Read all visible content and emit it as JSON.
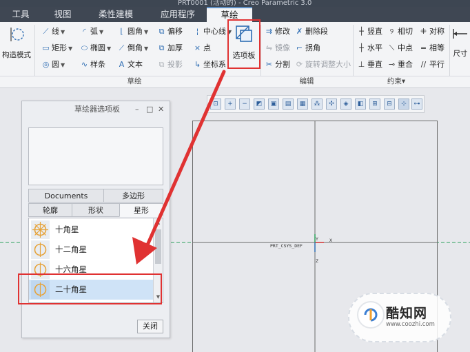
{
  "window": {
    "title": "PRT0001 (活动的) - Creo Parametric 3.0"
  },
  "tabs": [
    {
      "label": "工具",
      "active": false
    },
    {
      "label": "视图",
      "active": false
    },
    {
      "label": "柔性建模",
      "active": false
    },
    {
      "label": "应用程序",
      "active": false
    },
    {
      "label": "草绘",
      "active": true
    }
  ],
  "ribbon": {
    "construction_mode": "构造模式",
    "sketch_col1": [
      "线",
      "矩形",
      "圆"
    ],
    "sketch_col2": [
      "弧",
      "椭圆",
      "样条"
    ],
    "sketch_col3": [
      "圆角",
      "倒角",
      "文本"
    ],
    "sketch_col4": [
      "偏移",
      "加厚",
      "投影"
    ],
    "sketch_col5": [
      "中心线",
      "点",
      "坐标系"
    ],
    "palette_button": "选项板",
    "edit_col1": [
      "修改",
      "镜像",
      "分割"
    ],
    "edit_col2": [
      "删除段",
      "拐角",
      "旋转调整大小"
    ],
    "constraint_col1": [
      "竖直",
      "水平",
      "垂直"
    ],
    "constraint_col2": [
      "相切",
      "中点",
      "重合"
    ],
    "constraint_col3": [
      "对称",
      "相等",
      "平行"
    ],
    "dimension": "尺寸",
    "groups": {
      "sketch": "草绘",
      "edit": "编辑",
      "constraint": "约束"
    },
    "constraint_dropdown": "▾"
  },
  "canvas": {
    "origin_label": "PRT_CSYS_DEF",
    "axis_x": "X",
    "axis_y": "Y",
    "axis_z": "Z"
  },
  "palette": {
    "title": "草绘器选项板",
    "tabs_row1": [
      "Documents",
      "多边形"
    ],
    "tabs_row2": [
      "轮廓",
      "形状",
      "星形"
    ],
    "active_tab": "星形",
    "items": [
      {
        "label": "十角星",
        "selected": false
      },
      {
        "label": "十二角星",
        "selected": false
      },
      {
        "label": "十六角星",
        "selected": false
      },
      {
        "label": "二十角星",
        "selected": true
      }
    ],
    "close_label": "关闭"
  },
  "watermark": {
    "brand": "酷知网",
    "url": "www.coozhi.com"
  },
  "colors": {
    "highlight_red": "#e03232",
    "axis_green": "#2aa05a",
    "accent_blue": "#2e6db3"
  }
}
